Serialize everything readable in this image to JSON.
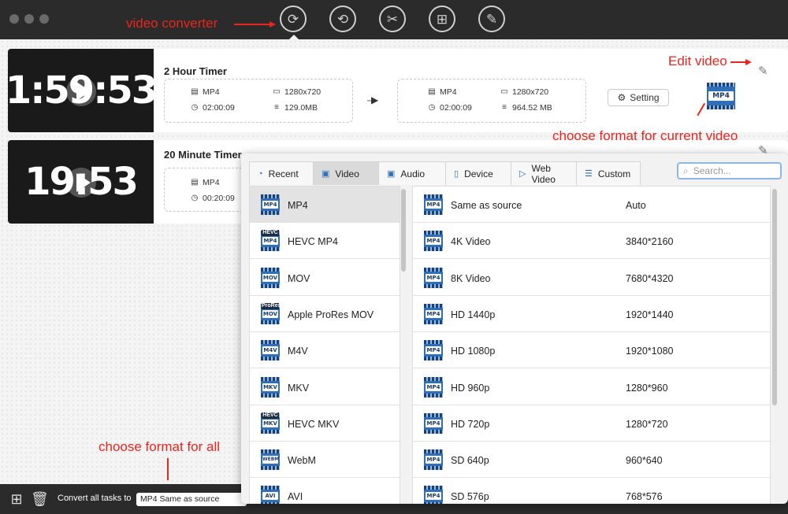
{
  "toolbar": {
    "tools": [
      {
        "name": "video-converter-tool",
        "icon": "convert-icon",
        "glyph": "⟳"
      },
      {
        "name": "video-compressor-tool",
        "icon": "compress-icon",
        "glyph": "⟲"
      },
      {
        "name": "video-editor-tool",
        "icon": "film-reel-icon",
        "glyph": "✂"
      },
      {
        "name": "video-merger-tool",
        "icon": "film-reel-merge-icon",
        "glyph": "⊞"
      },
      {
        "name": "video-trimmer-tool",
        "icon": "film-reel-cut-icon",
        "glyph": "✎"
      }
    ]
  },
  "tasks": [
    {
      "title": "2 Hour Timer",
      "thumb_text": "1:59:53",
      "source": {
        "format": "MP4",
        "resolution": "1280x720",
        "duration": "02:00:09",
        "size": "129.0MB"
      },
      "output": {
        "format": "MP4",
        "resolution": "1280x720",
        "duration": "02:00:09",
        "size": "964.52 MB"
      },
      "setting_label": "Setting",
      "format_badge": "MP4"
    },
    {
      "title": "20 Minute Timer",
      "thumb_text": "19:53",
      "source": {
        "format": "MP4",
        "duration": "00:20:09"
      }
    }
  ],
  "annotations": {
    "video_converter": "video converter",
    "edit_video": "Edit video",
    "choose_format_current": "choose format for current video",
    "choose_format_all": "choose format for all"
  },
  "bottombar": {
    "convert_all_label": "Convert all tasks to",
    "convert_all_value": "MP4 Same as source"
  },
  "popup": {
    "tabs": [
      {
        "label": "Recent",
        "icon": "recent-icon"
      },
      {
        "label": "Video",
        "icon": "video-icon"
      },
      {
        "label": "Audio",
        "icon": "audio-icon"
      },
      {
        "label": "Device",
        "icon": "device-icon"
      },
      {
        "label": "Web Video",
        "icon": "web-video-icon"
      },
      {
        "label": "Custom",
        "icon": "custom-sliders-icon"
      }
    ],
    "active_tab": "Video",
    "search_placeholder": "Search...",
    "formats": [
      {
        "name": "MP4",
        "badge": "MP4"
      },
      {
        "name": "HEVC MP4",
        "badge": "MP4",
        "top": "HEVC"
      },
      {
        "name": "MOV",
        "badge": "MOV"
      },
      {
        "name": "Apple ProRes MOV",
        "badge": "MOV",
        "top": "ProRes"
      },
      {
        "name": "M4V",
        "badge": "M4V"
      },
      {
        "name": "MKV",
        "badge": "MKV"
      },
      {
        "name": "HEVC MKV",
        "badge": "MKV",
        "top": "HEVC"
      },
      {
        "name": "WebM",
        "badge": "WEBM"
      },
      {
        "name": "AVI",
        "badge": "AVI"
      }
    ],
    "presets": [
      {
        "name": "Same as source",
        "resolution": "Auto"
      },
      {
        "name": "4K Video",
        "resolution": "3840*2160"
      },
      {
        "name": "8K Video",
        "resolution": "7680*4320"
      },
      {
        "name": "HD 1440p",
        "resolution": "1920*1440"
      },
      {
        "name": "HD 1080p",
        "resolution": "1920*1080"
      },
      {
        "name": "HD 960p",
        "resolution": "1280*960"
      },
      {
        "name": "HD 720p",
        "resolution": "1280*720"
      },
      {
        "name": "SD 640p",
        "resolution": "960*640"
      },
      {
        "name": "SD 576p",
        "resolution": "768*576"
      }
    ],
    "preset_badge": "MP4"
  },
  "colors": {
    "annotation": "#e8261e",
    "accent": "#2e6fb8",
    "titlebar": "#2b2b2b"
  }
}
